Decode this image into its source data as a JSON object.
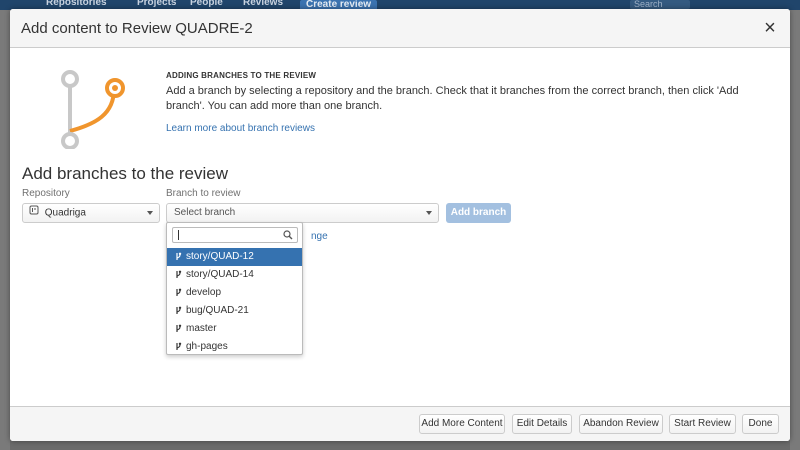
{
  "background": {
    "nav": [
      "Repositories",
      "Projects",
      "People",
      "Reviews",
      "Create review"
    ],
    "search_placeholder": "Search"
  },
  "dialog": {
    "title": "Add content to Review QUADRE-2",
    "close_label": "×",
    "intro": {
      "heading": "ADDING BRANCHES TO THE REVIEW",
      "text": "Add a branch by selecting a repository and the branch. Check that it branches from the correct branch, then click 'Add branch'. You can add more than one branch.",
      "link": "Learn more about branch reviews"
    },
    "section_title": "Add branches to the review",
    "repository": {
      "label": "Repository",
      "value": "Quadriga"
    },
    "branch": {
      "label": "Branch to review",
      "placeholder": "Select branch"
    },
    "add_branch_label": "Add branch",
    "partial_link": "nge",
    "dropdown": {
      "search_value": "",
      "items": [
        {
          "label": "story/QUAD-12",
          "selected": true
        },
        {
          "label": "story/QUAD-14",
          "selected": false
        },
        {
          "label": "develop",
          "selected": false
        },
        {
          "label": "bug/QUAD-21",
          "selected": false
        },
        {
          "label": "master",
          "selected": false
        },
        {
          "label": "gh-pages",
          "selected": false
        }
      ]
    },
    "footer": {
      "add_more": "Add More Content",
      "edit_details": "Edit Details",
      "abandon": "Abandon Review",
      "start": "Start Review",
      "done": "Done"
    }
  },
  "colors": {
    "accent": "#3572b0",
    "icon_orange": "#f0952d",
    "icon_gray": "#c8c8c8",
    "header_bg": "#20456b"
  }
}
